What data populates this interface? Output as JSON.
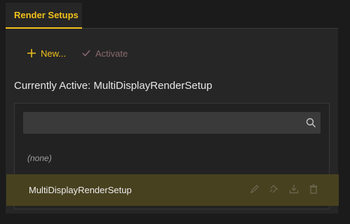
{
  "tabs": [
    {
      "label": "Render Setups",
      "active": true
    }
  ],
  "toolbar": {
    "new_label": "New...",
    "activate_label": "Activate"
  },
  "current_active": {
    "text": "Currently Active: MultiDisplayRenderSetup"
  },
  "search": {
    "value": "",
    "placeholder": ""
  },
  "list": {
    "items": [
      {
        "label": "(none)",
        "selected": false
      },
      {
        "label": "MultiDisplayRenderSetup",
        "selected": true
      }
    ]
  },
  "row_actions": [
    "edit-icon",
    "rename-icon",
    "download-icon",
    "delete-icon"
  ],
  "colors": {
    "accent": "#f2c21b",
    "panel_bg": "#262626",
    "selected_row_bg": "#48411f",
    "disabled_text": "#8a6a70"
  }
}
